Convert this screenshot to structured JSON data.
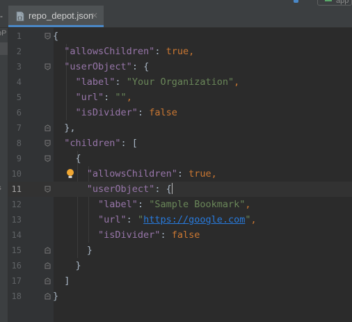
{
  "tabs": [
    {
      "label": "repo_depot.json",
      "close": "×"
    }
  ],
  "left_stub": "-",
  "left_strip": {
    "frag1": "oP",
    "frag2": "ts"
  },
  "top_right": {
    "label": "app"
  },
  "editor": {
    "current_line": 11,
    "lines": [
      {
        "num": "1",
        "code": [
          {
            "t": "{",
            "c": "p"
          }
        ]
      },
      {
        "num": "2",
        "code": [
          {
            "t": "  ",
            "c": "p"
          },
          {
            "t": "\"allowsChildren\"",
            "c": "k"
          },
          {
            "t": ": ",
            "c": "p"
          },
          {
            "t": "true",
            "c": "b"
          },
          {
            "t": ",",
            "c": "b"
          }
        ]
      },
      {
        "num": "3",
        "code": [
          {
            "t": "  ",
            "c": "p"
          },
          {
            "t": "\"userObject\"",
            "c": "k"
          },
          {
            "t": ": {",
            "c": "p"
          }
        ]
      },
      {
        "num": "4",
        "code": [
          {
            "t": "    ",
            "c": "p"
          },
          {
            "t": "\"label\"",
            "c": "k"
          },
          {
            "t": ": ",
            "c": "p"
          },
          {
            "t": "\"Your Organization\"",
            "c": "s"
          },
          {
            "t": ",",
            "c": "b"
          }
        ]
      },
      {
        "num": "5",
        "code": [
          {
            "t": "    ",
            "c": "p"
          },
          {
            "t": "\"url\"",
            "c": "k"
          },
          {
            "t": ": ",
            "c": "p"
          },
          {
            "t": "\"\"",
            "c": "s"
          },
          {
            "t": ",",
            "c": "b"
          }
        ]
      },
      {
        "num": "6",
        "code": [
          {
            "t": "    ",
            "c": "p"
          },
          {
            "t": "\"isDivider\"",
            "c": "k"
          },
          {
            "t": ": ",
            "c": "p"
          },
          {
            "t": "false",
            "c": "b"
          }
        ]
      },
      {
        "num": "7",
        "code": [
          {
            "t": "  },",
            "c": "p"
          }
        ]
      },
      {
        "num": "8",
        "code": [
          {
            "t": "  ",
            "c": "p"
          },
          {
            "t": "\"children\"",
            "c": "k"
          },
          {
            "t": ": [",
            "c": "p"
          }
        ]
      },
      {
        "num": "9",
        "code": [
          {
            "t": "    {",
            "c": "p"
          }
        ]
      },
      {
        "num": "10",
        "code": [
          {
            "t": "      ",
            "c": "p"
          },
          {
            "t": "\"allowsChildren\"",
            "c": "k"
          },
          {
            "t": ": ",
            "c": "p"
          },
          {
            "t": "true",
            "c": "b"
          },
          {
            "t": ",",
            "c": "b"
          }
        ]
      },
      {
        "num": "11",
        "code": [
          {
            "t": "      ",
            "c": "p"
          },
          {
            "t": "\"userObject\"",
            "c": "k"
          },
          {
            "t": ": {",
            "c": "p"
          },
          {
            "t": "",
            "c": "caret"
          }
        ]
      },
      {
        "num": "12",
        "code": [
          {
            "t": "        ",
            "c": "p"
          },
          {
            "t": "\"label\"",
            "c": "k"
          },
          {
            "t": ": ",
            "c": "p"
          },
          {
            "t": "\"Sample Bookmark\"",
            "c": "s"
          },
          {
            "t": ",",
            "c": "b"
          }
        ]
      },
      {
        "num": "13",
        "code": [
          {
            "t": "        ",
            "c": "p"
          },
          {
            "t": "\"url\"",
            "c": "k"
          },
          {
            "t": ": ",
            "c": "p"
          },
          {
            "t": "\"",
            "c": "s"
          },
          {
            "t": "https://google.com",
            "c": "u"
          },
          {
            "t": "\"",
            "c": "s"
          },
          {
            "t": ",",
            "c": "b"
          }
        ]
      },
      {
        "num": "14",
        "code": [
          {
            "t": "        ",
            "c": "p"
          },
          {
            "t": "\"isDivider\"",
            "c": "k"
          },
          {
            "t": ": ",
            "c": "p"
          },
          {
            "t": "false",
            "c": "b"
          }
        ]
      },
      {
        "num": "15",
        "code": [
          {
            "t": "      }",
            "c": "p"
          }
        ]
      },
      {
        "num": "16",
        "code": [
          {
            "t": "    }",
            "c": "p"
          }
        ]
      },
      {
        "num": "17",
        "code": [
          {
            "t": "  ]",
            "c": "p"
          }
        ]
      },
      {
        "num": "18",
        "code": [
          {
            "t": "}",
            "c": "p"
          }
        ]
      }
    ],
    "fold_lines": [
      1,
      3,
      7,
      8,
      9,
      11,
      15,
      16,
      17,
      18
    ],
    "fold_ends": [
      7,
      15,
      16,
      17,
      18
    ],
    "bulb_line": 10
  },
  "colors": {
    "editor_bg": "#2b2b2b",
    "gutter_bg": "#313335",
    "key": "#9876aa",
    "string": "#6a8759",
    "keyword": "#cc7832",
    "link": "#287bde",
    "tab_accent": "#4a88c7"
  },
  "icons": [
    "json-file-icon",
    "close-icon",
    "fold-icon",
    "lightbulb-icon"
  ]
}
